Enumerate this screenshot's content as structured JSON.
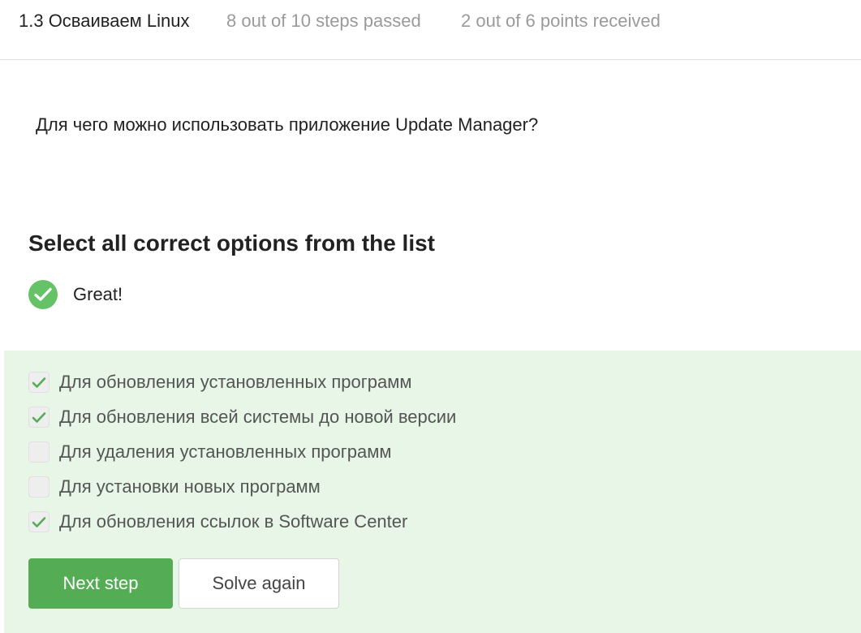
{
  "header": {
    "lesson_title": "1.3 Осваиваем Linux",
    "steps_progress": "8 out of 10 steps passed",
    "points_progress": "2 out of 6 points  received"
  },
  "question": {
    "text": "Для чего можно использовать приложение Update Manager?"
  },
  "quiz": {
    "instruction": "Select all correct options from the list",
    "feedback": {
      "icon": "check-circle-icon",
      "text": "Great!",
      "color": "#66c266"
    },
    "options": [
      {
        "label": "Для обновления установленных программ",
        "checked": true
      },
      {
        "label": "Для обновления всей системы до новой версии",
        "checked": true
      },
      {
        "label": "Для удаления установленных программ",
        "checked": false
      },
      {
        "label": "Для установки новых программ",
        "checked": false
      },
      {
        "label": "Для обновления ссылок в Software Center",
        "checked": true
      }
    ],
    "panel_color": "#e7f6e7",
    "checkmark_color": "#54ad54"
  },
  "actions": {
    "next_label": "Next step",
    "solve_again_label": "Solve again",
    "primary_color": "#54ad54"
  }
}
